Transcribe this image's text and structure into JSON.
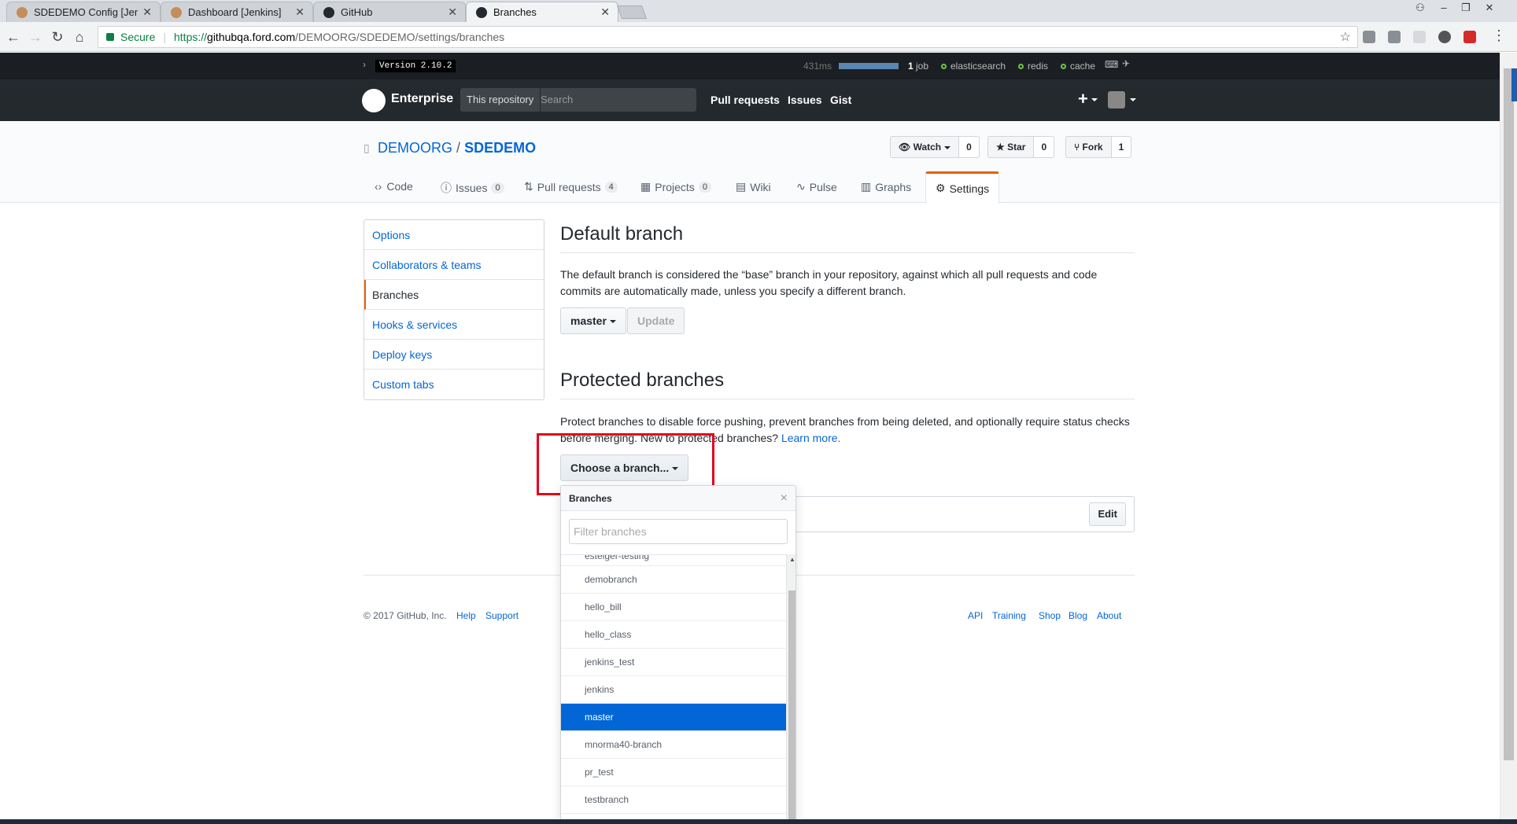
{
  "browser": {
    "tabs": [
      {
        "title": "SDEDEMO Config [Jenkins]"
      },
      {
        "title": "Dashboard [Jenkins]"
      },
      {
        "title": "GitHub"
      },
      {
        "title": "Branches"
      }
    ],
    "secure_label": "Secure",
    "url_scheme": "https://",
    "url_host": "githubqa.ford.com",
    "url_path": "/DEMOORG/SDEDEMO/settings/branches"
  },
  "stats": {
    "version": "Version 2.10.2",
    "time": "431ms",
    "job_count": "1",
    "job_label": "job",
    "services": [
      "elasticsearch",
      "redis",
      "cache"
    ]
  },
  "header": {
    "brand": "Enterprise",
    "scope": "This repository",
    "search_placeholder": "Search",
    "nav": [
      "Pull requests",
      "Issues",
      "Gist"
    ],
    "plus": "+"
  },
  "repo": {
    "owner": "DEMOORG",
    "slash": "/",
    "name": "SDEDEMO",
    "watch_label": "Watch",
    "watch_count": "0",
    "star_label": "Star",
    "star_count": "0",
    "fork_label": "Fork",
    "fork_count": "1",
    "tabs": {
      "code": "Code",
      "issues": "Issues",
      "issues_count": "0",
      "pulls": "Pull requests",
      "pulls_count": "4",
      "projects": "Projects",
      "projects_count": "0",
      "wiki": "Wiki",
      "pulse": "Pulse",
      "graphs": "Graphs",
      "settings": "Settings"
    }
  },
  "settings_menu": [
    "Options",
    "Collaborators & teams",
    "Branches",
    "Hooks & services",
    "Deploy keys",
    "Custom tabs"
  ],
  "default_branch": {
    "heading": "Default branch",
    "description": "The default branch is considered the “base” branch in your repository, against which all pull requests and code commits are automatically made, unless you specify a different branch.",
    "branch_button": "master",
    "update_button": "Update"
  },
  "protected": {
    "heading": "Protected branches",
    "description": "Protect branches to disable force pushing, prevent branches from being deleted, and optionally require status checks before merging. New to protected branches?",
    "learn_more": "Learn more.",
    "choose_button": "Choose a branch...",
    "edit_button": "Edit"
  },
  "dropdown": {
    "header": "Branches",
    "close": "×",
    "filter_placeholder": "Filter branches",
    "partial_item": "esteiger-testing",
    "items": [
      "demobranch",
      "hello_bill",
      "hello_class",
      "jenkins_test",
      "jenkins",
      "master",
      "mnorma40-branch",
      "pr_test",
      "testbranch"
    ],
    "selected": "master"
  },
  "footer": {
    "copyright": "© 2017 GitHub, Inc.",
    "left_links": [
      "Help",
      "Support"
    ],
    "right_links": [
      "API",
      "Training",
      "Shop",
      "Blog",
      "About"
    ]
  },
  "colors": {
    "accent_orange": "#e36209",
    "link_blue": "#0366d6",
    "selection_blue": "#0366d6",
    "highlight_red": "#e3001b",
    "header_dark": "#24292e"
  }
}
